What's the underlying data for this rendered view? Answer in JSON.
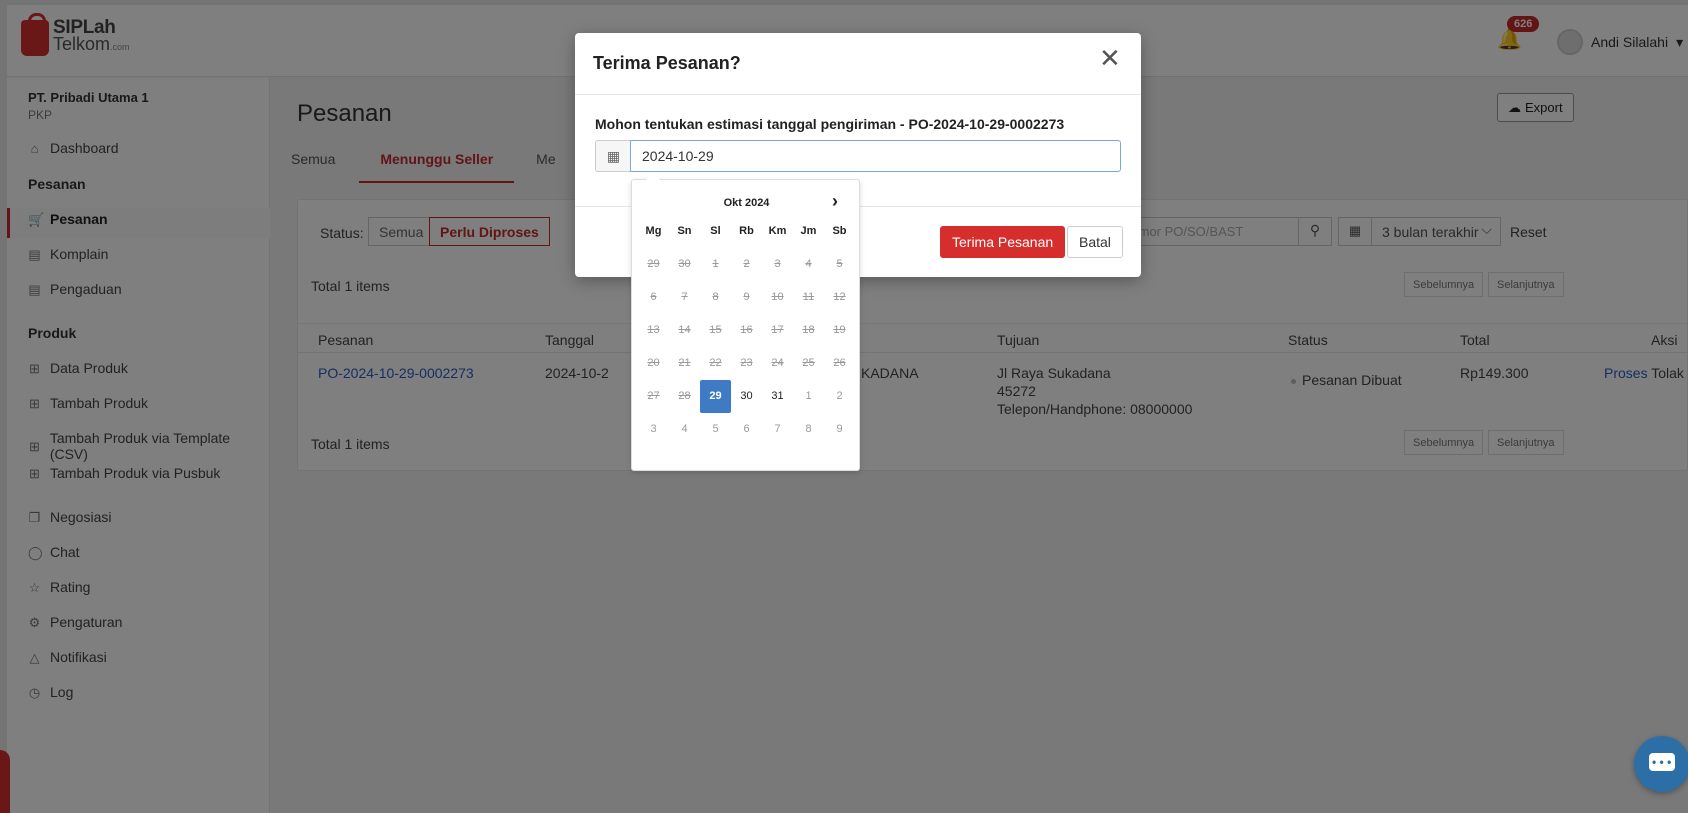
{
  "header": {
    "logo_line1": "SIPLah",
    "logo_line2": "Telkom",
    "logo_suffix": ".com",
    "notification_count": "626",
    "user_name": "Andi Silalahi"
  },
  "sidebar": {
    "org_name": "PT. Pribadi Utama 1",
    "org_type": "PKP",
    "dashboard": "Dashboard",
    "section_pesanan": "Pesanan",
    "pesanan": "Pesanan",
    "komplain": "Komplain",
    "pengaduan": "Pengaduan",
    "section_produk": "Produk",
    "data_produk": "Data Produk",
    "tambah_produk": "Tambah Produk",
    "tambah_csv": "Tambah Produk via Template (CSV)",
    "tambah_pusbuk": "Tambah Produk via Pusbuk",
    "negosiasi": "Negosiasi",
    "chat": "Chat",
    "rating": "Rating",
    "pengaturan": "Pengaturan",
    "notifikasi": "Notifikasi",
    "log": "Log"
  },
  "main": {
    "title": "Pesanan",
    "export_label": "Export",
    "tabs": [
      "Semua",
      "Menunggu Seller",
      "Me"
    ],
    "status_label": "Status:",
    "status_all": "Semua",
    "status_process": "Perlu Diproses",
    "search_placeholder": "Nomor PO/SO/BAST",
    "date_range": "3 bulan terakhir",
    "reset_label": "Reset",
    "total_items": "Total 1 items",
    "prev_label": "Sebelumnya",
    "next_label": "Selanjutnya",
    "columns": [
      "Pesanan",
      "Tanggal",
      "Tujuan",
      "Status",
      "Total",
      "Aksi"
    ],
    "row": {
      "po": "PO-2024-10-29-0002273",
      "date": "2024-10-2",
      "buyer_fragment": "KADANA",
      "addr1": "Jl Raya Sukadana",
      "addr2": "45272",
      "addr3": "Telepon/Handphone: 08000000",
      "status": "Pesanan Dibuat",
      "total": "Rp149.300",
      "action_process": "Proses",
      "action_reject": "Tolak"
    }
  },
  "modal": {
    "title": "Terima Pesanan?",
    "label": "Mohon tentukan estimasi tanggal pengiriman - PO-2024-10-29-0002273",
    "date_value": "2024-10-29",
    "accept_label": "Terima Pesanan",
    "cancel_label": "Batal"
  },
  "datepicker": {
    "month_label": "Okt 2024",
    "weekdays": [
      "Mg",
      "Sn",
      "Sl",
      "Rb",
      "Km",
      "Jm",
      "Sb"
    ],
    "weeks": [
      [
        "29",
        "30",
        "1",
        "2",
        "3",
        "4",
        "5"
      ],
      [
        "6",
        "7",
        "8",
        "9",
        "10",
        "11",
        "12"
      ],
      [
        "13",
        "14",
        "15",
        "16",
        "17",
        "18",
        "19"
      ],
      [
        "20",
        "21",
        "22",
        "23",
        "24",
        "25",
        "26"
      ],
      [
        "27",
        "28",
        "29",
        "30",
        "31",
        "1",
        "2"
      ],
      [
        "3",
        "4",
        "5",
        "6",
        "7",
        "8",
        "9"
      ]
    ],
    "selected_day": "29"
  },
  "colors": {
    "accent_red": "#c62828",
    "link_blue": "#2a5dc2",
    "selected_blue": "#3f7ac4"
  }
}
